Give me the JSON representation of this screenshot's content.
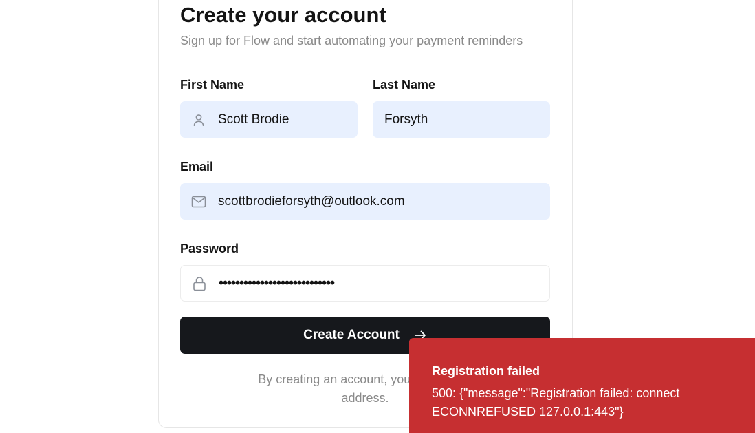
{
  "header": {
    "title": "Create your account",
    "subtitle": "Sign up for Flow and start automating your payment reminders"
  },
  "form": {
    "first_name_label": "First Name",
    "first_name_value": "Scott Brodie",
    "last_name_label": "Last Name",
    "last_name_value": "Forsyth",
    "email_label": "Email",
    "email_value": "scottbrodieforsyth@outlook.com",
    "password_label": "Password",
    "password_value": "••••••••••••••••••••••••••••",
    "submit_label": "Create Account",
    "terms_text": "By creating an account, you'll receive a                                  address."
  },
  "toast": {
    "title": "Registration failed",
    "message": "500: {\"message\":\"Registration failed: connect ECONNREFUSED 127.0.0.1:443\"}"
  },
  "icons": {
    "first_name": "user-icon",
    "email": "mail-icon",
    "password": "lock-icon",
    "submit": "arrow-right-icon"
  },
  "colors": {
    "input_autofill_bg": "#e8f0fe",
    "button_bg": "#16181c",
    "toast_bg": "#c62f31"
  }
}
